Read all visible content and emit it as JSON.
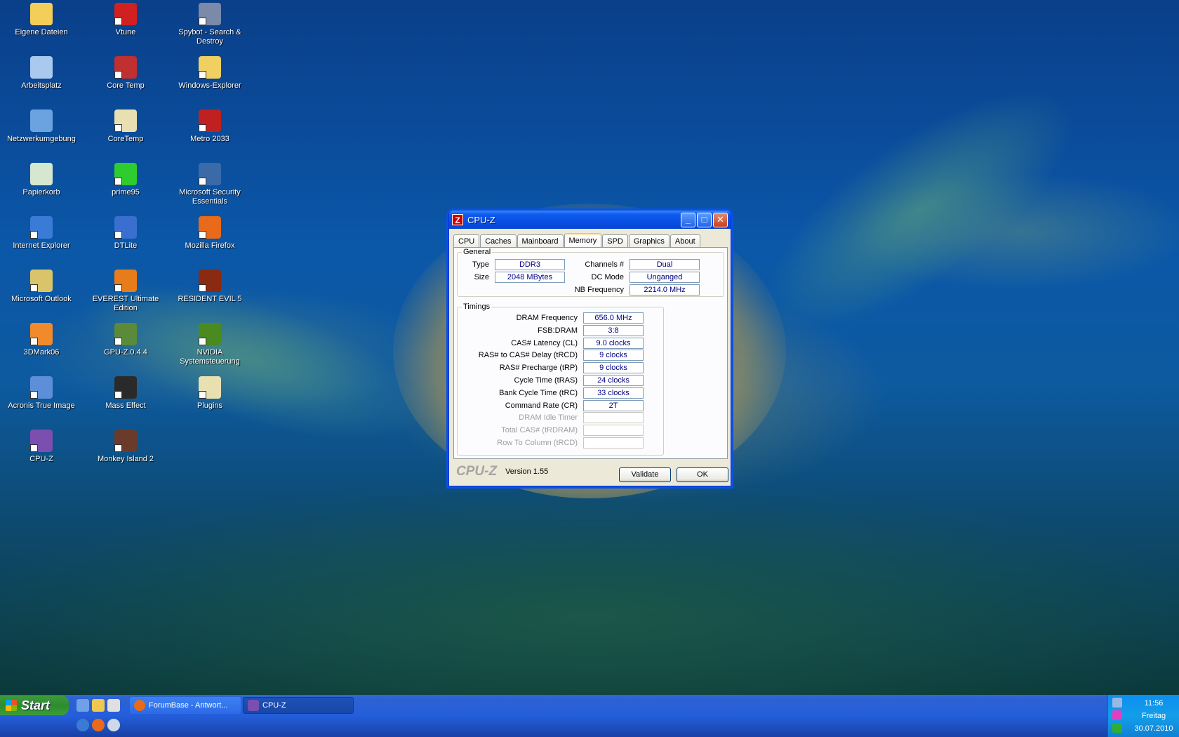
{
  "desktop": {
    "icons": [
      {
        "label": "Eigene Dateien",
        "icon": "folder-icon",
        "color": "#f3cf5a"
      },
      {
        "label": "Arbeitsplatz",
        "icon": "computer-icon",
        "color": "#a9c9ef"
      },
      {
        "label": "Netzwerkumgebung",
        "icon": "network-icon",
        "color": "#6aa3e0"
      },
      {
        "label": "Papierkorb",
        "icon": "recycle-bin-icon",
        "color": "#d6e7d0"
      },
      {
        "label": "Internet Explorer",
        "icon": "internet-explorer-icon",
        "color": "#3a7bd5"
      },
      {
        "label": "Microsoft Outlook",
        "icon": "outlook-icon",
        "color": "#d9c46a"
      },
      {
        "label": "3DMark06",
        "icon": "3dmark-icon",
        "color": "#f08a2b"
      },
      {
        "label": "Acronis True Image",
        "icon": "acronis-icon",
        "color": "#5d8fd8"
      },
      {
        "label": "CPU-Z",
        "icon": "cpu-z-icon",
        "color": "#7a4fb0"
      },
      {
        "label": "Vtune",
        "icon": "vtune-icon",
        "color": "#d02020"
      },
      {
        "label": "Core Temp",
        "icon": "core-temp-icon",
        "color": "#c03030"
      },
      {
        "label": "CoreTemp",
        "icon": "coretemp-notepad-icon",
        "color": "#e8e0b0"
      },
      {
        "label": "prime95",
        "icon": "prime95-icon",
        "color": "#2ecc2e"
      },
      {
        "label": "DTLite",
        "icon": "dtlite-icon",
        "color": "#3a6fd0"
      },
      {
        "label": "EVEREST Ultimate Edition",
        "icon": "everest-icon",
        "color": "#e67c1a"
      },
      {
        "label": "GPU-Z.0.4.4",
        "icon": "gpu-z-icon",
        "color": "#5a8a3a"
      },
      {
        "label": "Mass Effect",
        "icon": "mass-effect-icon",
        "color": "#2a2a2a"
      },
      {
        "label": "Monkey Island 2",
        "icon": "monkey-island-icon",
        "color": "#6a3a2a"
      },
      {
        "label": "Spybot - Search & Destroy",
        "icon": "spybot-icon",
        "color": "#7a8aa8"
      },
      {
        "label": "Windows-Explorer",
        "icon": "windows-explorer-icon",
        "color": "#f0d060"
      },
      {
        "label": "Metro 2033",
        "icon": "metro-2033-icon",
        "color": "#c02020"
      },
      {
        "label": "Microsoft Security Essentials",
        "icon": "security-essentials-icon",
        "color": "#3a6aa8"
      },
      {
        "label": "Mozilla Firefox",
        "icon": "firefox-icon",
        "color": "#e86a1a"
      },
      {
        "label": "RESIDENT EVIL 5",
        "icon": "resident-evil-icon",
        "color": "#8a2a10"
      },
      {
        "label": "NVIDIA Systemsteuerung",
        "icon": "nvidia-icon",
        "color": "#4a8a20"
      },
      {
        "label": "Plugins",
        "icon": "plugins-icon",
        "color": "#e8e0b0"
      }
    ]
  },
  "window": {
    "title": "CPU-Z",
    "app_icon_glyph": "Z",
    "tabs": [
      "CPU",
      "Caches",
      "Mainboard",
      "Memory",
      "SPD",
      "Graphics",
      "About"
    ],
    "active_tab": "Memory",
    "general": {
      "legend": "General",
      "type_label": "Type",
      "type_value": "DDR3",
      "size_label": "Size",
      "size_value": "2048 MBytes",
      "channels_label": "Channels #",
      "channels_value": "Dual",
      "dcmode_label": "DC Mode",
      "dcmode_value": "Unganged",
      "nbfreq_label": "NB Frequency",
      "nbfreq_value": "2214.0 MHz"
    },
    "timings": {
      "legend": "Timings",
      "rows": [
        {
          "label": "DRAM Frequency",
          "value": "656.0 MHz",
          "enabled": true
        },
        {
          "label": "FSB:DRAM",
          "value": "3:8",
          "enabled": true
        },
        {
          "label": "CAS# Latency (CL)",
          "value": "9.0 clocks",
          "enabled": true
        },
        {
          "label": "RAS# to CAS# Delay (tRCD)",
          "value": "9 clocks",
          "enabled": true
        },
        {
          "label": "RAS# Precharge (tRP)",
          "value": "9 clocks",
          "enabled": true
        },
        {
          "label": "Cycle Time (tRAS)",
          "value": "24 clocks",
          "enabled": true
        },
        {
          "label": "Bank Cycle Time (tRC)",
          "value": "33 clocks",
          "enabled": true
        },
        {
          "label": "Command Rate (CR)",
          "value": "2T",
          "enabled": true
        },
        {
          "label": "DRAM Idle Timer",
          "value": "",
          "enabled": false
        },
        {
          "label": "Total CAS# (tRDRAM)",
          "value": "",
          "enabled": false
        },
        {
          "label": "Row To Column (tRCD)",
          "value": "",
          "enabled": false
        }
      ]
    },
    "footer": {
      "brand": "CPU-Z",
      "version": "Version 1.55",
      "validate_label": "Validate",
      "ok_label": "OK"
    }
  },
  "taskbar": {
    "start_label": "Start",
    "tasks": [
      {
        "label": "ForumBase - Antwort...",
        "icon": "firefox-icon"
      },
      {
        "label": "CPU-Z",
        "icon": "cpu-z-icon"
      }
    ],
    "quicklaunch_icons": [
      "show-desktop-icon",
      "explorer-icon",
      "media-icon",
      "ie-icon",
      "firefox-icon",
      "media-player-icon"
    ],
    "clock_time": "11:56",
    "clock_day": "Freitag",
    "clock_date": "30.07.2010"
  }
}
